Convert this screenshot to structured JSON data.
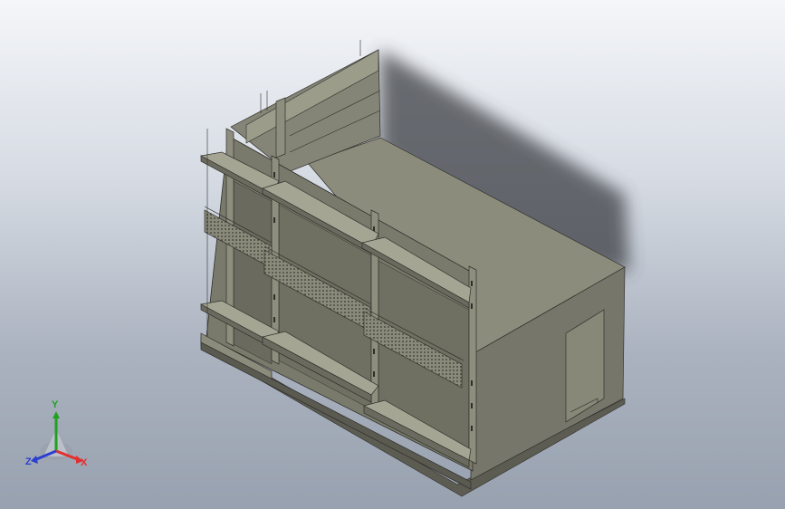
{
  "viewport": {
    "background_top": "#f4f6f9",
    "background_bottom": "#98a1af"
  },
  "model": {
    "name": "store-shelving-unit-with-room-box",
    "colors": {
      "body": "#7e7e6f",
      "body_dark": "#5f5f54",
      "body_light": "#9a9a89",
      "edge": "#2e2e2a",
      "shadow": "#3c3f44"
    }
  },
  "triad": {
    "x_label": "X",
    "y_label": "Y",
    "z_label": "Z",
    "x_color": "#e03030",
    "y_color": "#22a022",
    "z_color": "#2a3fd0"
  }
}
